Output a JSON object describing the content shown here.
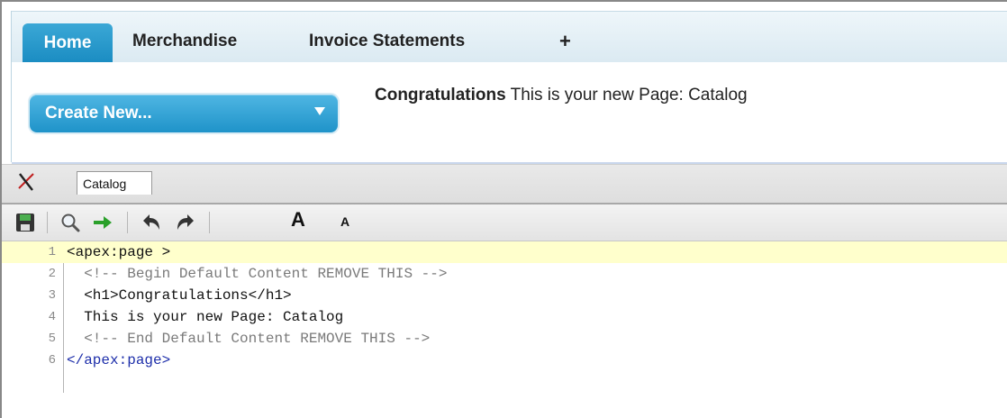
{
  "tabs": {
    "home": "Home",
    "merchandise": "Merchandise",
    "invoice_statements": "Invoice Statements",
    "add": "+"
  },
  "header": {
    "create_new": "Create New...",
    "congrats_bold": "Congratulations",
    "congrats_rest": " This is your new Page: Catalog"
  },
  "editor": {
    "page_name": "Catalog",
    "toolbar": {
      "save_icon": "save-icon",
      "search_icon": "search-icon",
      "goto_icon": "green-arrow-icon",
      "undo_icon": "undo-icon",
      "redo_icon": "redo-icon",
      "font_increase": "A",
      "font_decrease": "A"
    },
    "lines": [
      {
        "num": "1",
        "text": "<apex:page >"
      },
      {
        "num": "2",
        "text": "  <!-- Begin Default Content REMOVE THIS -->"
      },
      {
        "num": "3",
        "text": "  <h1>Congratulations</h1>"
      },
      {
        "num": "4",
        "text": "  This is your new Page: Catalog"
      },
      {
        "num": "5",
        "text": "  <!-- End Default Content REMOVE THIS -->"
      },
      {
        "num": "6",
        "text": "</apex:page>"
      }
    ]
  },
  "colors": {
    "tab_active": "#1a8cc2",
    "current_line": "#ffffcc",
    "comment": "#7a7a7a"
  }
}
